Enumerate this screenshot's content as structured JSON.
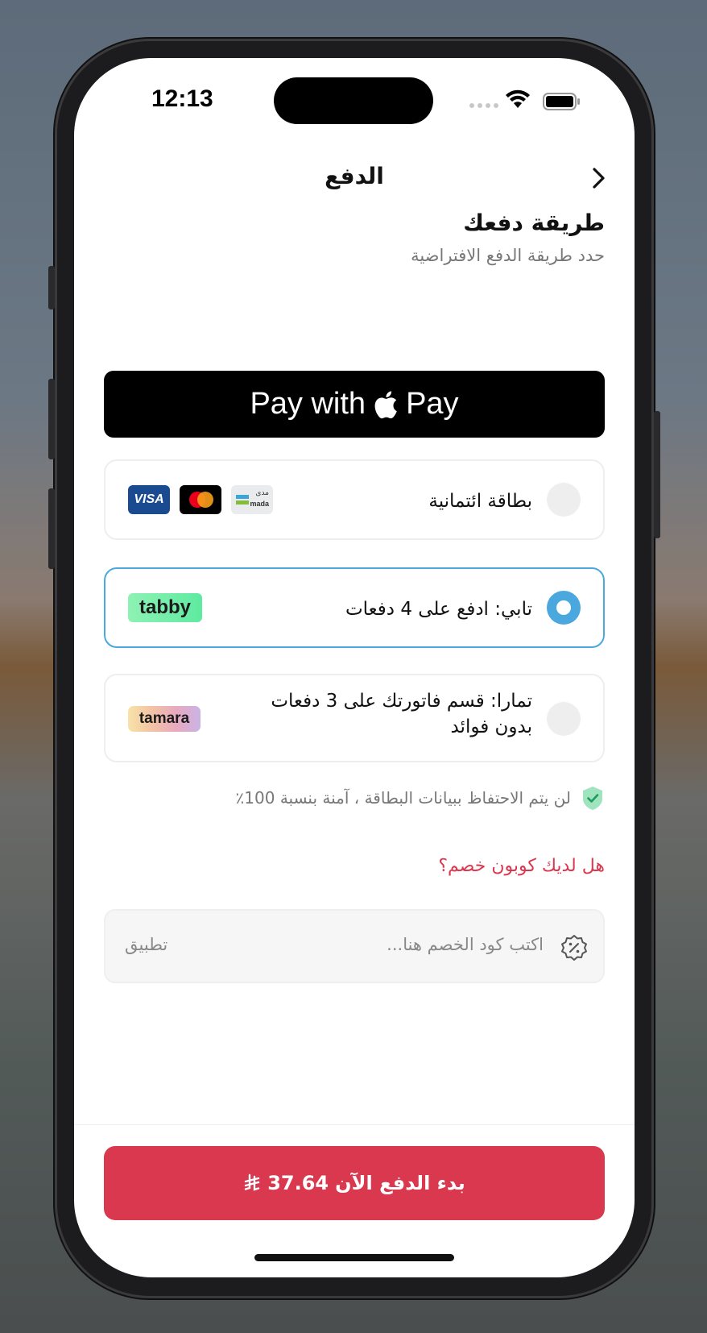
{
  "status_bar": {
    "time": "12:13"
  },
  "nav": {
    "title": "الدفع"
  },
  "payment_method": {
    "title": "طريقة دفعك",
    "subtitle": "حدد طريقة الدفع الافتراضية"
  },
  "apple_pay": {
    "label_before": "Pay with",
    "label_after": "Pay"
  },
  "options": [
    {
      "label": "بطاقة ائتمانية",
      "selected": false,
      "logos": [
        "visa-logo",
        "mastercard-logo",
        "mada-logo"
      ]
    },
    {
      "label": "تابي: ادفع على 4 دفعات",
      "selected": true,
      "logos": [
        "tabby-logo"
      ]
    },
    {
      "label_line1": "تمارا: قسم فاتورتك على 3 دفعات",
      "label_line2": "بدون فوائد",
      "selected": false,
      "logos": [
        "tamara-logo"
      ]
    }
  ],
  "logos": {
    "visa": "VISA",
    "mada_ar": "مدى",
    "mada_en": "mada",
    "tabby": "tabby",
    "tamara": "tamara"
  },
  "secure_note": "لن يتم الاحتفاظ ببيانات البطاقة ، آمنة بنسبة 100٪",
  "coupon": {
    "question": "هل لديك كوبون خصم؟",
    "placeholder": "اكتب كود الخصم هنا...",
    "apply_label": "تطبيق"
  },
  "pay_button": {
    "label": "بدء الدفع الآن",
    "amount": "37.64",
    "currency_symbol": "⃁"
  },
  "colors": {
    "accent": "#d9384f",
    "selected": "#4aa8de",
    "tabby": "#3effa9"
  }
}
